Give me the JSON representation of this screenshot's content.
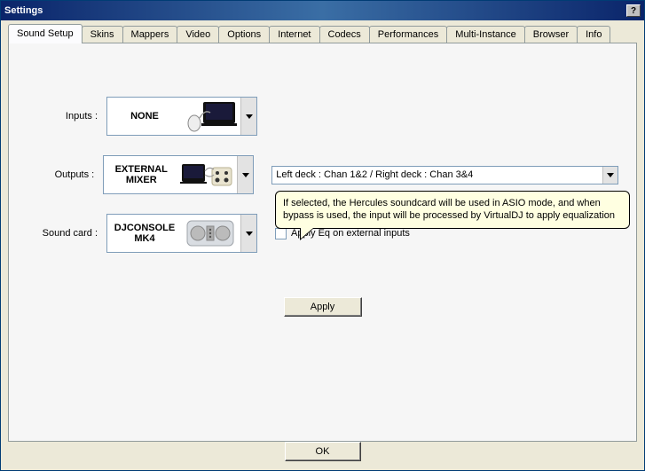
{
  "window": {
    "title": "Settings"
  },
  "tabs": {
    "t0": "Sound Setup",
    "t1": "Skins",
    "t2": "Mappers",
    "t3": "Video",
    "t4": "Options",
    "t5": "Internet",
    "t6": "Codecs",
    "t7": "Performances",
    "t8": "Multi-Instance",
    "t9": "Browser",
    "t10": "Info"
  },
  "labels": {
    "inputs": "Inputs :",
    "outputs": "Outputs :",
    "soundcard": "Sound card :"
  },
  "combos": {
    "inputs": "NONE",
    "outputs": "EXTERNAL MIXER",
    "soundcard": "DJCONSOLE MK4"
  },
  "channel_select": "Left deck : Chan 1&2 / Right deck : Chan 3&4",
  "checkbox": {
    "apply_eq": "Apply Eq on external inputs"
  },
  "tooltip": "If selected, the Hercules soundcard will be used in ASIO mode, and when bypass is used, the input will be processed by VirtualDJ to apply equalization",
  "buttons": {
    "apply": "Apply",
    "ok": "OK"
  }
}
